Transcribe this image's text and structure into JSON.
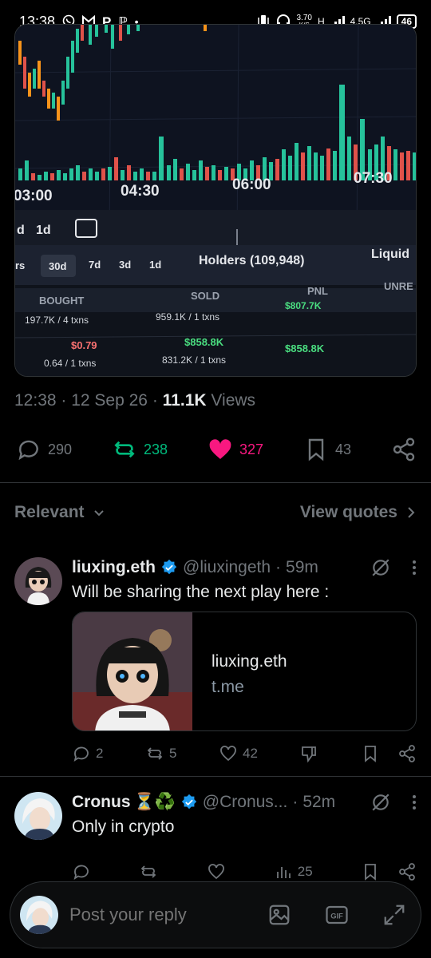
{
  "status_bar": {
    "time": "13:38",
    "left_icons": [
      "whatsapp-icon",
      "gmail-icon",
      "p-icon",
      "app-icon",
      "dot"
    ],
    "net_speed_value": "3.70",
    "net_speed_unit": "K/S",
    "net_h": "H",
    "net_4g": "4.5G",
    "battery": "46"
  },
  "media": {
    "time_labels": [
      "03:00",
      "04:30",
      "06:00",
      "07:30"
    ],
    "tf_1": "d",
    "tf_2": "1d",
    "tabs": [
      "rs",
      "30d",
      "7d",
      "3d",
      "1d"
    ],
    "holders_label": "Holders (109,948)",
    "liquid_label": "Liquid",
    "col_bought": "BOUGHT",
    "col_sold": "SOLD",
    "col_pnl": "PNL",
    "col_unre": "UNRE",
    "row1_bought": "197.7K / 4 txns",
    "row1_sold": "959.1K / 1 txns",
    "row1_pnl": "$807.7K",
    "row2_bought_price": "$0.79",
    "row2_bought": "0.64 / 1 txns",
    "row2_sold_price": "$858.8K",
    "row2_sold": "831.2K / 1 txns",
    "row2_pnl": "$858.8K"
  },
  "post_meta": {
    "time": "12:38",
    "date": "12 Sep 26",
    "views_count": "11.1K",
    "views_label": "Views"
  },
  "post_actions": {
    "replies": "290",
    "reposts": "238",
    "likes": "327",
    "bookmarks": "43"
  },
  "filter": {
    "relevant": "Relevant",
    "view_quotes": "View quotes"
  },
  "replies": [
    {
      "name": "liuxing.eth",
      "handle": "@liuxingeth",
      "time": "59m",
      "text": "Will be sharing the next play here :",
      "card_title": "liuxing.eth",
      "card_domain": "t.me",
      "replies": "2",
      "reposts": "5",
      "likes": "42"
    },
    {
      "name": "Cronus",
      "emoji": "⏳♻️",
      "handle": "@Cronus...",
      "time": "52m",
      "text": "Only in crypto",
      "views": "25"
    }
  ],
  "composer": {
    "placeholder": "Post your reply"
  },
  "colors": {
    "accent_blue": "#1d9bf0",
    "repost_green": "#00ba7c",
    "like_pink": "#f91880",
    "muted": "#71767b"
  }
}
